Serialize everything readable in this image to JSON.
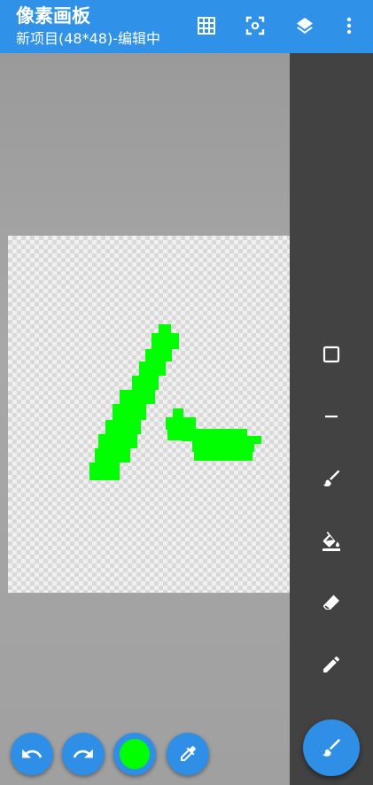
{
  "app": {
    "title": "像素画板",
    "subtitle": "新项目(48*48)-编辑中",
    "primary_color": "#2f92e8"
  },
  "toolbar_actions": [
    {
      "name": "grid-icon"
    },
    {
      "name": "focus-center-icon"
    },
    {
      "name": "layers-icon"
    },
    {
      "name": "more-vert-icon"
    }
  ],
  "tools": [
    {
      "name": "rectangle-tool",
      "icon": "square-outline-icon"
    },
    {
      "name": "line-tool",
      "icon": "minus-icon"
    },
    {
      "name": "brush-tool",
      "icon": "brush-icon"
    },
    {
      "name": "fill-tool",
      "icon": "paint-bucket-icon"
    },
    {
      "name": "eraser-tool",
      "icon": "eraser-icon"
    },
    {
      "name": "pencil-tool",
      "icon": "pencil-icon"
    }
  ],
  "active_tool": "brush-icon",
  "current_color": "#00ff00",
  "bottom_actions": [
    {
      "name": "undo-button",
      "icon": "undo-icon"
    },
    {
      "name": "redo-button",
      "icon": "redo-icon"
    },
    {
      "name": "color-picker-button",
      "icon": "color-swatch"
    },
    {
      "name": "eyedropper-button",
      "icon": "eyedropper-icon"
    }
  ]
}
